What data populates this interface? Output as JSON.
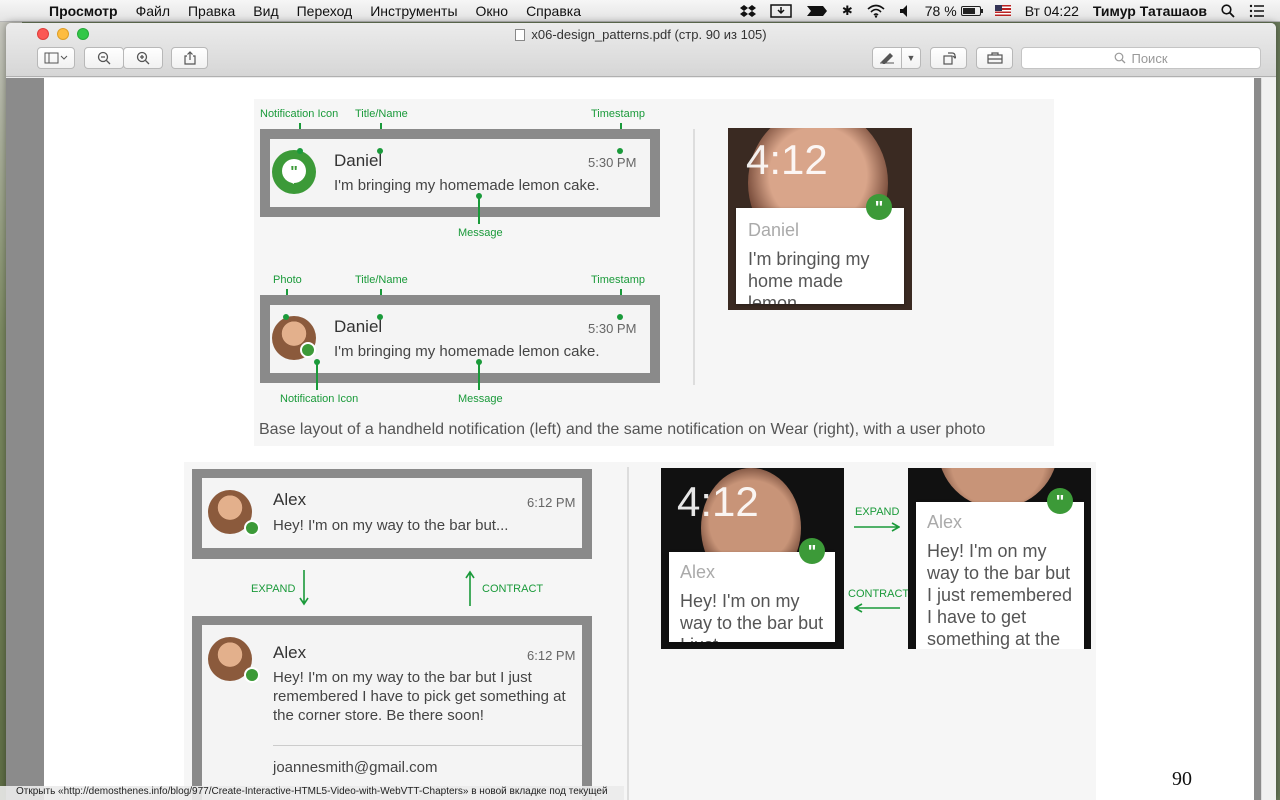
{
  "menubar": {
    "app_name": "Просмотр",
    "menus": [
      "Файл",
      "Правка",
      "Вид",
      "Переход",
      "Инструменты",
      "Окно",
      "Справка"
    ],
    "battery": "78 %",
    "battery_level": 0.78,
    "clock": "Вт 04:22",
    "user": "Тимур Таташаов"
  },
  "window": {
    "title": "x06-design_patterns.pdf (стр. 90 из 105)",
    "search_placeholder": "Поиск"
  },
  "figure1": {
    "labels": {
      "notification_icon": "Notification Icon",
      "title_name": "Title/Name",
      "timestamp": "Timestamp",
      "message": "Message",
      "photo": "Photo"
    },
    "card": {
      "name": "Daniel",
      "time": "5:30 PM",
      "message": "I'm bringing my homemade lemon cake."
    },
    "wear": {
      "time": "4:12",
      "name": "Daniel",
      "message": "I'm bringing my home made lemon"
    },
    "caption": "Base layout of a handheld notification (left) and the same notification on Wear (right), with a user photo"
  },
  "figure2": {
    "card": {
      "name": "Alex",
      "time": "6:12 PM",
      "message_short": "Hey! I'm on my way to the bar but...",
      "message_long": "Hey! I'm on my way to the bar but I just remembered I have to pick get something at the corner store. Be there soon!",
      "email": "joannesmith@gmail.com"
    },
    "expand": "EXPAND",
    "contract": "CONTRACT",
    "wear_collapsed": {
      "time": "4:12",
      "name": "Alex",
      "message": "Hey! I'm on my way to the bar but I just"
    },
    "wear_expanded": {
      "name": "Alex",
      "message": "Hey! I'm on my way to the bar but I just remembered I have to get something at the corner store."
    }
  },
  "page_number": "90",
  "status_bar": "Открыть «http://demosthenes.info/blog/977/Create-Interactive-HTML5-Video-with-WebVTT-Chapters» в новой вкладке под текущей"
}
